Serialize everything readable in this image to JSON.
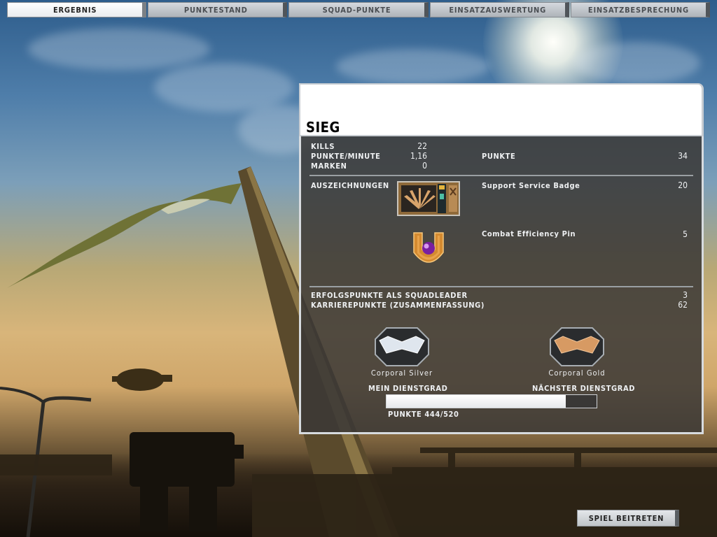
{
  "tabs": [
    {
      "label": "ERGEBNIS",
      "active": true
    },
    {
      "label": "PUNKTESTAND",
      "active": false
    },
    {
      "label": "SQUAD-PUNKTE",
      "active": false
    },
    {
      "label": "EINSATZAUSWERTUNG",
      "active": false
    },
    {
      "label": "EINSATZBESPRECHUNG",
      "active": false
    }
  ],
  "result": {
    "title": "SIEG",
    "stats": [
      {
        "label": "KILLS",
        "value": "22"
      },
      {
        "label": "PUNKTE/MINUTE",
        "value": "1,16"
      },
      {
        "label": "MARKEN",
        "value": "0"
      }
    ],
    "points_label": "PUNKTE",
    "points_value": "34"
  },
  "awards": {
    "label": "AUSZEICHNUNGEN",
    "items": [
      {
        "name": "Support Service Badge",
        "value": "20",
        "icon": "badge-icon"
      },
      {
        "name": "Combat Efficiency Pin",
        "value": "5",
        "icon": "pin-icon"
      }
    ]
  },
  "summary": [
    {
      "label": "ERFOLGSPUNKTE ALS SQUADLEADER",
      "value": "3"
    },
    {
      "label": "KARRIEREPUNKTE (ZUSAMMENFASSUNG)",
      "value": "62"
    }
  ],
  "rank": {
    "current": {
      "name": "Corporal Silver",
      "caption": "MEIN DIENSTGRAD",
      "color": "#dfe6ee"
    },
    "next": {
      "name": "Corporal Gold",
      "caption": "NÄCHSTER DIENSTGRAD",
      "color": "#d79a63"
    },
    "progress_text": "PUNKTE 444/520",
    "progress_fraction": 0.854
  },
  "join_button": "SPIEL BEITRETEN"
}
